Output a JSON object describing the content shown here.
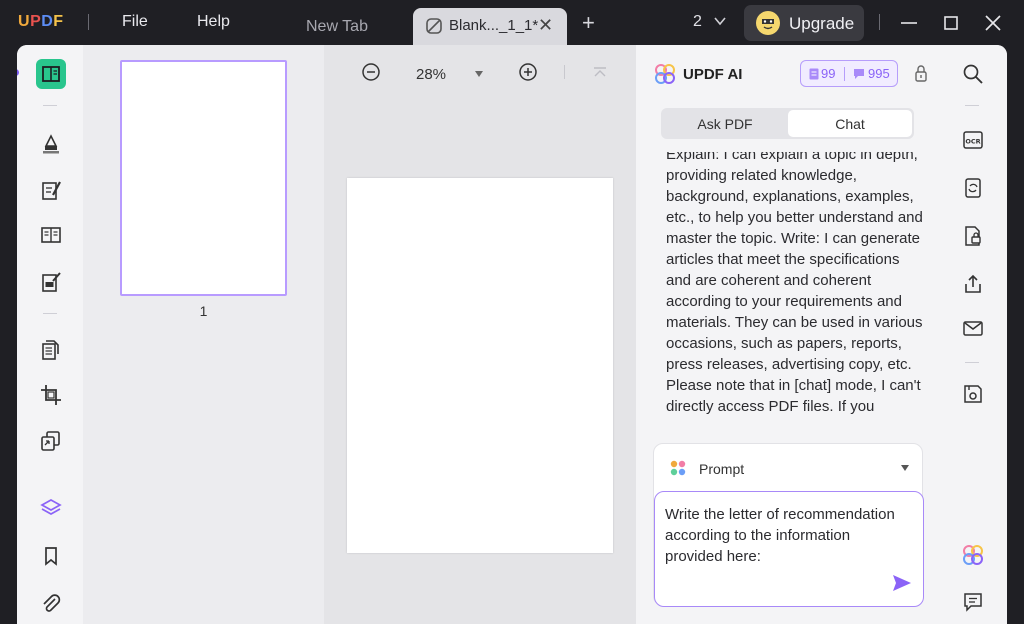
{
  "app": {
    "logo_letters": [
      "U",
      "P",
      "D",
      "F"
    ],
    "logo_colors": [
      "#f0a93c",
      "#e8524f",
      "#5c8df5",
      "#f4c24a"
    ]
  },
  "menu": {
    "file": "File",
    "help": "Help"
  },
  "tabs": [
    {
      "label": "New Tab",
      "active": false
    },
    {
      "label": "Blank..._1_1*",
      "active": true
    }
  ],
  "titlebar": {
    "new_tab_glyph": "+",
    "close_tab_glyph": "✕",
    "window_count": "2",
    "upgrade_label": "Upgrade"
  },
  "thumbnails": {
    "pages": [
      {
        "number": "1",
        "selected": true
      }
    ]
  },
  "viewer": {
    "zoom_level": "28%"
  },
  "ai": {
    "title": "UPDF AI",
    "credits_doc": "99",
    "credits_chat": "995",
    "modes": [
      "Ask PDF",
      "Chat"
    ],
    "active_mode": "Chat",
    "message": "Explain: I can explain a topic in depth, providing related knowledge, background, explanations, examples, etc., to help you better understand and master the topic. Write: I can generate articles that meet the specifications and are coherent and coherent according to your requirements and materials. They can be used in various occasions, such as papers, reports, press releases, advertising copy, etc. Please note that in [chat] mode, I can't directly access PDF files. If you",
    "prompt_label": "Prompt",
    "input_text": "Write the letter of recommendation according to the information provided here:"
  },
  "colors": {
    "accent_purple": "#8b63f7",
    "accent_green": "#29c58d",
    "titlebar_bg": "#1f1f24"
  }
}
